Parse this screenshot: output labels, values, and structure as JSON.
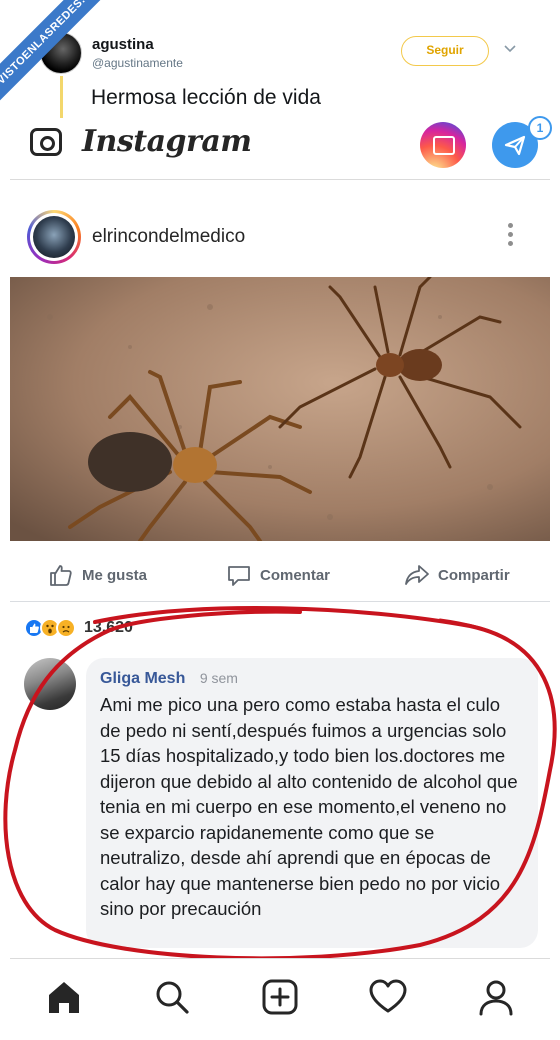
{
  "watermark": {
    "text": "VISTOENLASREDES.COM"
  },
  "tweet": {
    "name": "agustina",
    "handle": "@agustinamente",
    "follow_label": "Seguir",
    "text": "Hermosa lección de vida"
  },
  "instagram": {
    "logo_text": "Instagram",
    "dm_badge": "1",
    "post": {
      "username": "elrincondelmedico"
    },
    "nav_icons": [
      "home-icon",
      "search-icon",
      "add-icon",
      "heart-icon",
      "profile-icon"
    ]
  },
  "facebook": {
    "actions": {
      "like": "Me gusta",
      "comment": "Comentar",
      "share": "Compartir"
    },
    "reaction_count": "13,620",
    "comment": {
      "author": "Gliga Mesh",
      "time": "9 sem",
      "text": "Ami me pico una pero como estaba hasta el culo de pedo ni sentí,después fuimos a urgencias solo 15 días hospitalizado,y todo bien los.doctores me dijeron que debido al alto contenido de alcohol que tenia en mi cuerpo en ese momento,el veneno no se exparcio rapidanemente como que se neutralizo, desde ahí aprendi que en épocas de calor hay que mantenerse bien pedo no por vicio sino por precaución"
    }
  },
  "colors": {
    "follow_border": "#f3c94b",
    "link_blue": "#385898",
    "annotation_red": "#c8141e",
    "dm_blue": "#3e99ed"
  }
}
